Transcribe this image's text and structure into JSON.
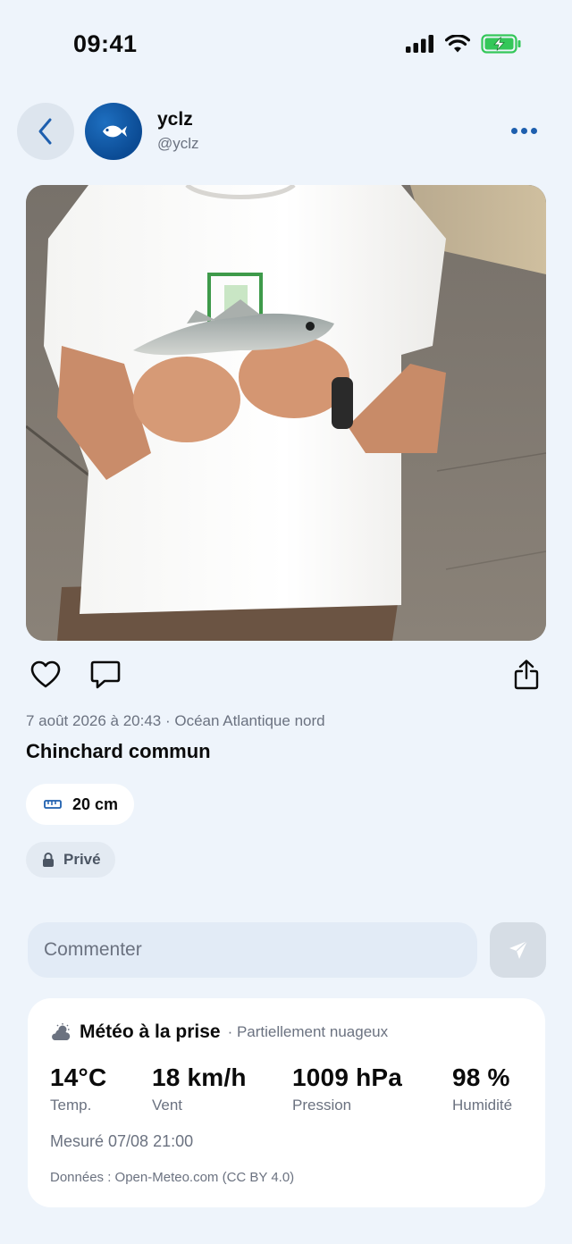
{
  "status_bar": {
    "time": "09:41"
  },
  "header": {
    "name": "yclz",
    "handle": "@yclz"
  },
  "post": {
    "meta": "7 août 2026 à 20:43 · Océan Atlantique nord",
    "species": "Chinchard commun",
    "size": "20 cm",
    "visibility": "Privé"
  },
  "comment": {
    "placeholder": "Commenter"
  },
  "weather": {
    "title": "Météo à la prise",
    "condition": "· Partiellement nuageux",
    "temp": {
      "value": "14°C",
      "label": "Temp."
    },
    "wind": {
      "value": "18 km/h",
      "label": "Vent"
    },
    "pressure": {
      "value": "1009 hPa",
      "label": "Pression"
    },
    "humidity": {
      "value": "98 %",
      "label": "Humidité"
    },
    "measured": "Mesuré 07/08 21:00",
    "source": "Données : Open-Meteo.com (CC BY 4.0)"
  },
  "icons": {
    "back": "chevron-left-icon",
    "avatar": "fish-icon",
    "more": "ellipsis-icon",
    "like": "heart-icon",
    "comment": "speech-bubble-icon",
    "share": "share-icon",
    "size": "ruler-icon",
    "visibility": "lock-icon",
    "send": "paper-plane-icon",
    "weather": "partly-cloudy-icon"
  },
  "colors": {
    "accent": "#1e5fae",
    "background": "#eef4fb",
    "battery": "#34c759"
  }
}
